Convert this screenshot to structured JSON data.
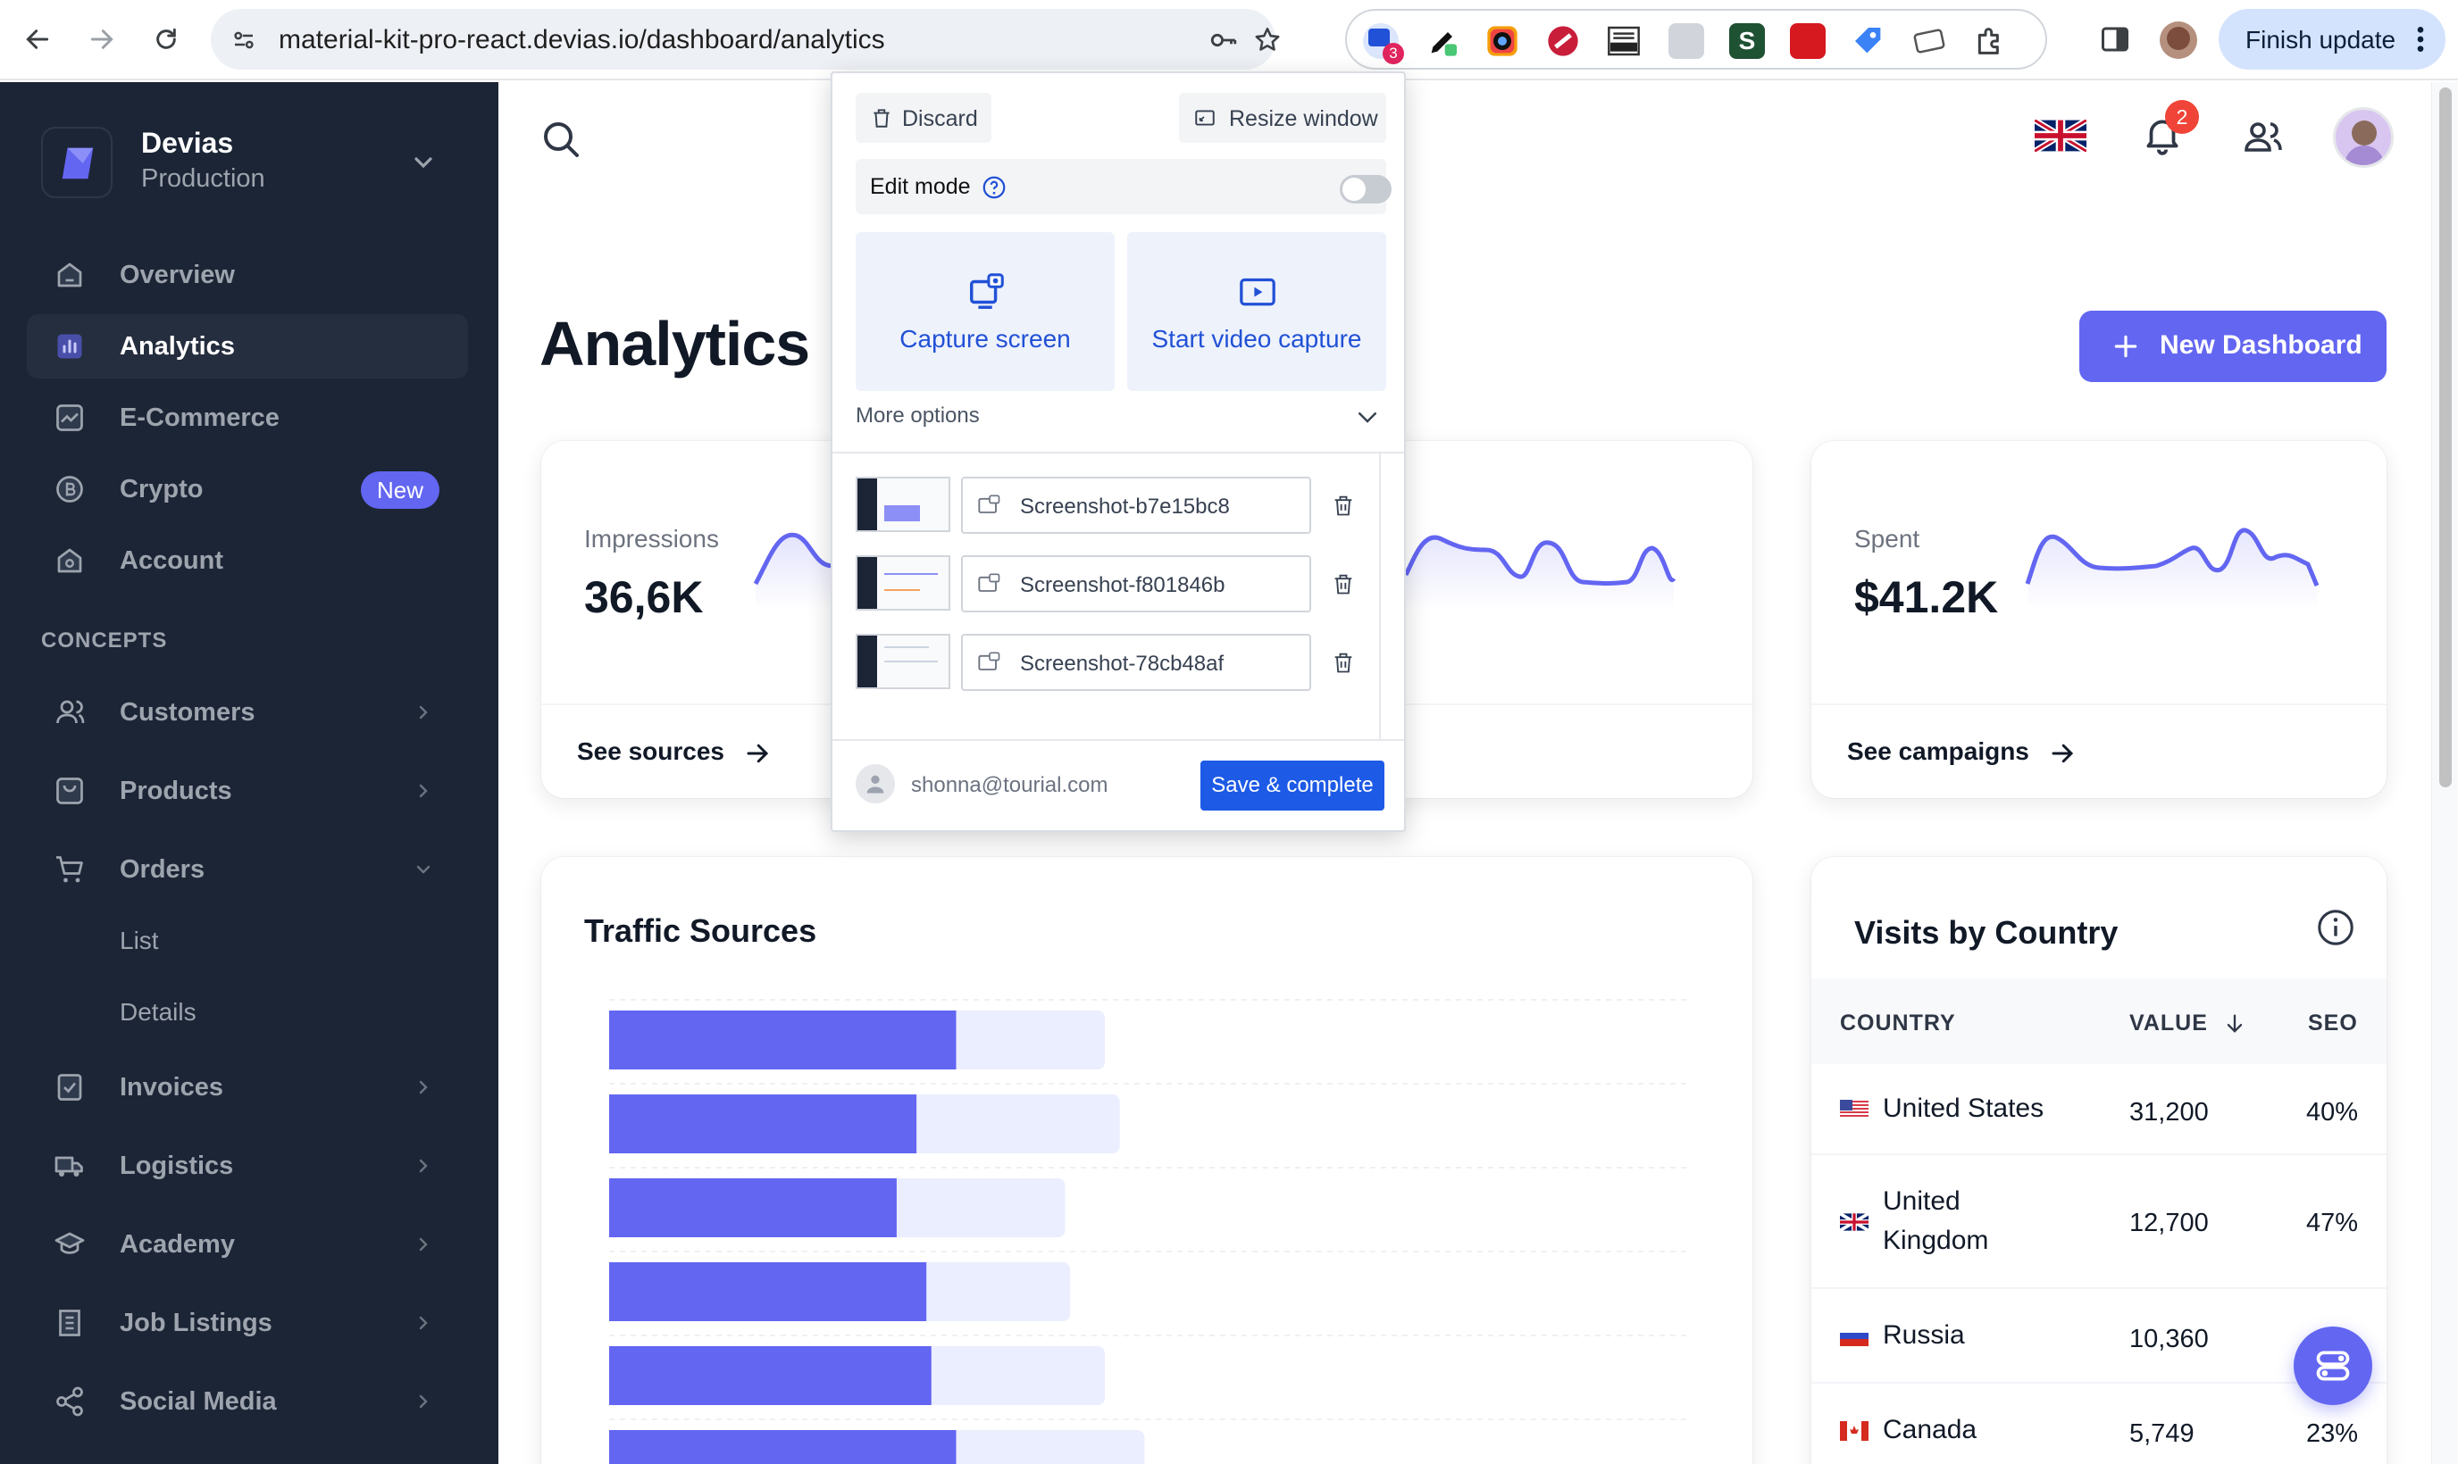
{
  "browser": {
    "url": "material-kit-pro-react.devias.io/dashboard/analytics",
    "extension_badge": "3",
    "finish_update_label": "Finish update"
  },
  "sidebar": {
    "org_name": "Devias",
    "org_env": "Production",
    "nav_items": [
      {
        "label": "Overview",
        "icon": "home-icon"
      },
      {
        "label": "Analytics",
        "icon": "bar-chart-icon",
        "active": true
      },
      {
        "label": "E-Commerce",
        "icon": "line-chart-icon"
      },
      {
        "label": "Crypto",
        "icon": "bitcoin-icon",
        "badge": "New"
      },
      {
        "label": "Account",
        "icon": "home-icon"
      }
    ],
    "concepts_title": "CONCEPTS",
    "concept_items": [
      {
        "label": "Customers",
        "icon": "users-icon"
      },
      {
        "label": "Products",
        "icon": "package-icon"
      },
      {
        "label": "Orders",
        "icon": "cart-icon",
        "expanded": true
      },
      {
        "label": "Invoices",
        "icon": "receipt-icon"
      },
      {
        "label": "Logistics",
        "icon": "truck-icon"
      },
      {
        "label": "Academy",
        "icon": "graduation-cap-icon"
      },
      {
        "label": "Job Listings",
        "icon": "building-icon"
      },
      {
        "label": "Social Media",
        "icon": "share-icon"
      }
    ],
    "orders_sub": [
      "List",
      "Details"
    ]
  },
  "header": {
    "notification_count": "2"
  },
  "page": {
    "title": "Analytics",
    "new_dashboard_label": "New Dashboard"
  },
  "stats": [
    {
      "label": "Impressions",
      "value": "36,6K",
      "link": "See sources"
    },
    {
      "label": "Spent",
      "value": "$41.2K",
      "link": "See campaigns"
    }
  ],
  "traffic": {
    "title": "Traffic Sources"
  },
  "chart_data": {
    "type": "bar",
    "orientation": "horizontal",
    "title": "Traffic Sources",
    "series": [
      {
        "values": [
          70,
          62,
          58,
          64,
          65,
          70
        ]
      },
      {
        "values": [
          100,
          103,
          92,
          93,
          100,
          108
        ]
      }
    ],
    "colors": [
      "#6366f1",
      "#ebeefe"
    ]
  },
  "visits": {
    "title": "Visits by Country",
    "columns": {
      "country": "COUNTRY",
      "value": "VALUE",
      "seo": "SEO"
    },
    "rows": [
      {
        "country": "United States",
        "value": "31,200",
        "seo": "40%"
      },
      {
        "country": "United Kingdom",
        "value": "12,700",
        "seo": "47%"
      },
      {
        "country": "Russia",
        "value": "10,360",
        "seo": ""
      },
      {
        "country": "Canada",
        "value": "5,749",
        "seo": "23%"
      }
    ]
  },
  "popup": {
    "discard_label": "Discard",
    "resize_label": "Resize window",
    "edit_mode_label": "Edit mode",
    "capture_label": "Capture screen",
    "video_label": "Start video capture",
    "more_options_label": "More options",
    "screenshots": [
      "Screenshot-b7e15bc8",
      "Screenshot-f801846b",
      "Screenshot-78cb48af"
    ],
    "user_email": "shonna@tourial.com",
    "save_label": "Save & complete"
  },
  "colors": {
    "accent": "#6366f1",
    "sidebar_bg": "#1c2536",
    "popup_blue": "#1d5ae6"
  }
}
